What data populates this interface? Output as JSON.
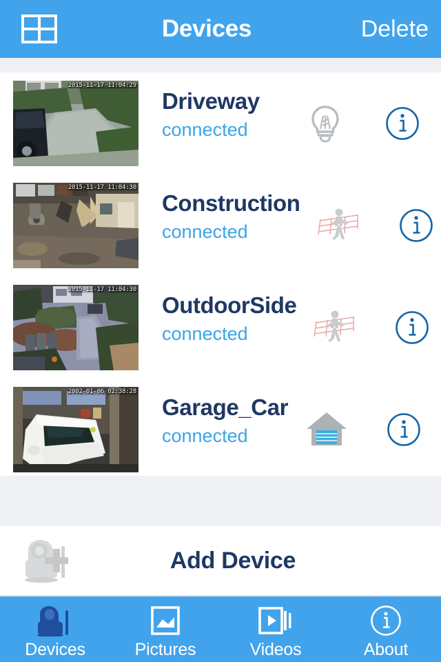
{
  "colors": {
    "brand_blue": "#41a3ec",
    "title_navy": "#1f3864",
    "status_blue": "#3aa5e8",
    "band_gray": "#eef0f4",
    "icon_gray": "#b9bcc0",
    "garage_door_blue": "#3aaee0",
    "active_tab_icon": "#1f4e9c"
  },
  "header": {
    "grid_icon": "grid-view-icon",
    "title": "Devices",
    "delete_label": "Delete"
  },
  "devices": [
    {
      "name": "Driveway",
      "status": "connected",
      "timestamp": "2015-11-17 11:04:29",
      "feature_icon": "lightbulb-icon",
      "detail_icon": "info-icon",
      "thumbnail": "driveway-camera-thumbnail"
    },
    {
      "name": "Construction",
      "status": "connected",
      "timestamp": "2015-11-17 11:04:30",
      "feature_icon": "tripwire-motion-icon",
      "detail_icon": "info-icon",
      "thumbnail": "construction-camera-thumbnail"
    },
    {
      "name": "OutdoorSide",
      "status": "connected",
      "timestamp": "2015-11-17 11:04:30",
      "feature_icon": "tripwire-motion-icon",
      "detail_icon": "info-icon",
      "thumbnail": "outdoorside-camera-thumbnail"
    },
    {
      "name": "Garage_Car",
      "status": "connected",
      "timestamp": "2002-01-06 02:38:28",
      "feature_icon": "garage-door-icon",
      "detail_icon": "info-icon",
      "thumbnail": "garage-camera-thumbnail"
    }
  ],
  "add_device": {
    "label": "Add Device",
    "icon": "add-camera-icon"
  },
  "tabs": [
    {
      "label": "Devices",
      "icon": "camera-icon",
      "active": true
    },
    {
      "label": "Pictures",
      "icon": "picture-icon",
      "active": false
    },
    {
      "label": "Videos",
      "icon": "video-icon",
      "active": false
    },
    {
      "label": "About",
      "icon": "info-icon",
      "active": false
    }
  ]
}
